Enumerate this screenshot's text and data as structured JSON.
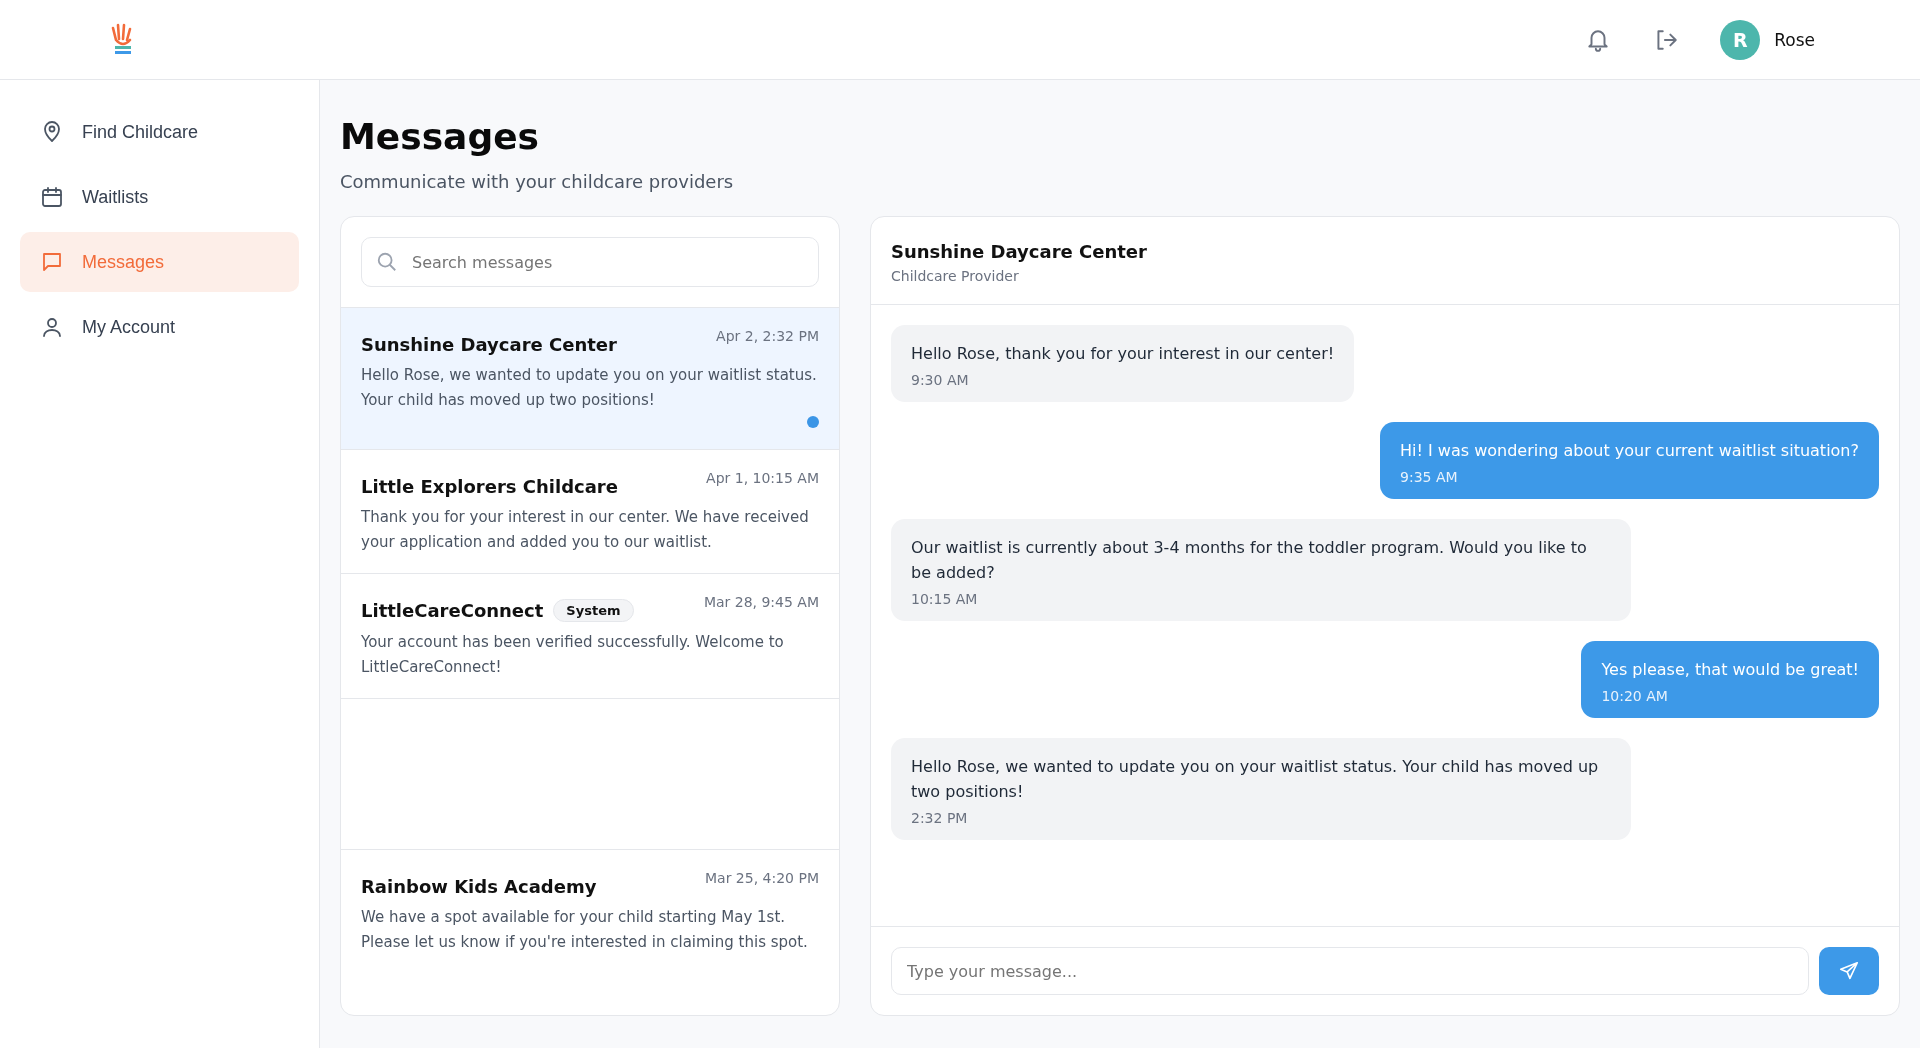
{
  "header": {
    "user": {
      "initial": "R",
      "name": "Rose"
    }
  },
  "sidebar": {
    "items": [
      {
        "label": "Find Childcare",
        "selected": false
      },
      {
        "label": "Waitlists",
        "selected": false
      },
      {
        "label": "Messages",
        "selected": true
      },
      {
        "label": "My Account",
        "selected": false
      }
    ]
  },
  "page": {
    "title": "Messages",
    "subtitle": "Communicate with your childcare providers"
  },
  "conversations": {
    "search": {
      "placeholder": "Search messages"
    },
    "items": [
      {
        "name": "Sunshine Daycare Center",
        "time": "Apr 2, 2:32 PM",
        "preview": "Hello Rose, we wanted to update you on your waitlist status. Your child has moved up two positions!",
        "selected": true,
        "unread": true
      },
      {
        "name": "Little Explorers Childcare",
        "time": "Apr 1, 10:15 AM",
        "preview": "Thank you for your interest in our center. We have received your application and added you to our waitlist.",
        "selected": false,
        "unread": false
      },
      {
        "name": "LittleCareConnect",
        "badge": "System",
        "time": "Mar 28, 9:45 AM",
        "preview": "Your account has been verified successfully. Welcome to LittleCareConnect!",
        "selected": false,
        "unread": false
      },
      {
        "kind": "blank"
      },
      {
        "name": "Rainbow Kids Academy",
        "time": "Mar 25, 4:20 PM",
        "preview": "We have a spot available for your child starting May 1st. Please let us know if you're interested in claiming this spot.",
        "selected": false,
        "unread": false
      }
    ]
  },
  "chat": {
    "title": "Sunshine Daycare Center",
    "subtitle": "Childcare Provider",
    "messages": [
      {
        "kind": "provider",
        "text": "Hello Rose, thank you for your interest in our center!",
        "time": "9:30 AM"
      },
      {
        "kind": "user",
        "text": "Hi! I was wondering about your current waitlist situation?",
        "time": "9:35 AM"
      },
      {
        "kind": "provider",
        "text": "Our waitlist is currently about 3-4 months for the toddler program. Would you like to be added?",
        "time": "10:15 AM"
      },
      {
        "kind": "user",
        "text": "Yes please, that would be great!",
        "time": "10:20 AM"
      },
      {
        "kind": "provider",
        "text": "Hello Rose, we wanted to update you on your waitlist status. Your child has moved up two positions!",
        "time": "2:32 PM"
      }
    ],
    "composer": {
      "placeholder": "Type your message..."
    }
  }
}
